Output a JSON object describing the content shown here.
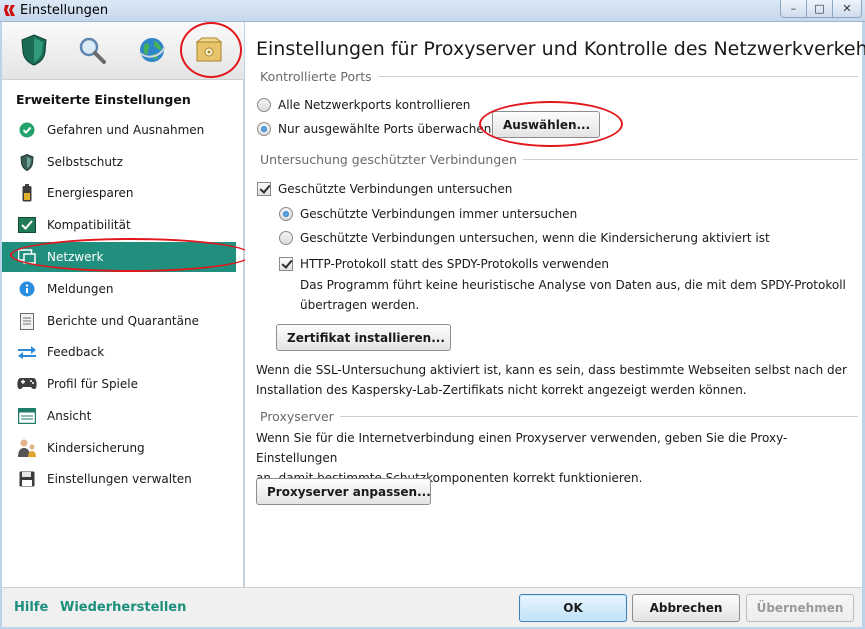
{
  "window": {
    "title": "Einstellungen",
    "controls": {
      "minimize": "–",
      "maximize": "□",
      "close": "✕"
    }
  },
  "sidebar": {
    "top_icons": [
      {
        "name": "shield-icon"
      },
      {
        "name": "magnifier-icon"
      },
      {
        "name": "globe-icon"
      },
      {
        "name": "settings-box-icon",
        "selected": true
      }
    ],
    "heading": "Erweiterte Einstellungen",
    "items": [
      {
        "label": "Gefahren und Ausnahmen",
        "icon": "check-circle-icon"
      },
      {
        "label": "Selbstschutz",
        "icon": "shield-small-icon"
      },
      {
        "label": "Energiesparen",
        "icon": "battery-icon"
      },
      {
        "label": "Kompatibilität",
        "icon": "compatibility-icon"
      },
      {
        "label": "Netzwerk",
        "icon": "network-icon",
        "active": true
      },
      {
        "label": "Meldungen",
        "icon": "info-icon"
      },
      {
        "label": "Berichte und Quarantäne",
        "icon": "report-icon"
      },
      {
        "label": "Feedback",
        "icon": "arrows-icon"
      },
      {
        "label": "Profil für Spiele",
        "icon": "gamepad-icon"
      },
      {
        "label": "Ansicht",
        "icon": "window-icon"
      },
      {
        "label": "Kindersicherung",
        "icon": "child-icon"
      },
      {
        "label": "Einstellungen verwalten",
        "icon": "floppy-icon"
      }
    ]
  },
  "main": {
    "title": "Einstellungen für Proxyserver und Kontrolle des Netzwerkverkehrs",
    "ports": {
      "section": "Kontrollierte Ports",
      "option_all": "Alle Netzwerkports kontrollieren",
      "option_selected": "Nur ausgewählte Ports überwachen",
      "select_button": "Auswählen..."
    },
    "secure": {
      "section": "Untersuchung geschützter Verbindungen",
      "check_scan": "Geschützte Verbindungen untersuchen",
      "radio_always": "Geschützte Verbindungen immer untersuchen",
      "radio_parental": "Geschützte Verbindungen untersuchen, wenn die Kindersicherung aktiviert ist",
      "check_http": "HTTP-Protokoll statt des SPDY-Protokolls verwenden",
      "http_desc_1": "Das Programm führt keine heuristische Analyse von Daten aus, die mit dem SPDY-Protokoll",
      "http_desc_2": "übertragen werden.",
      "cert_button": "Zertifikat installieren...",
      "ssl_note_1": "Wenn die SSL-Untersuchung aktiviert ist, kann es sein, dass bestimmte Webseiten selbst nach der",
      "ssl_note_2": "Installation des Kaspersky-Lab-Zertifikats nicht korrekt angezeigt werden können."
    },
    "proxy": {
      "section": "Proxyserver",
      "desc_1": "Wenn Sie für die Internetverbindung einen Proxyserver verwenden, geben Sie die Proxy-Einstellungen",
      "desc_2": "an, damit bestimmte Schutzkomponenten korrekt funktionieren.",
      "button": "Proxyserver anpassen..."
    }
  },
  "footer": {
    "help": "Hilfe",
    "restore": "Wiederherstellen",
    "ok": "OK",
    "cancel": "Abbrechen",
    "apply": "Übernehmen"
  },
  "colors": {
    "accent": "#218f7e",
    "link": "#1b8f7c",
    "highlight_ring": "#e2161b"
  }
}
